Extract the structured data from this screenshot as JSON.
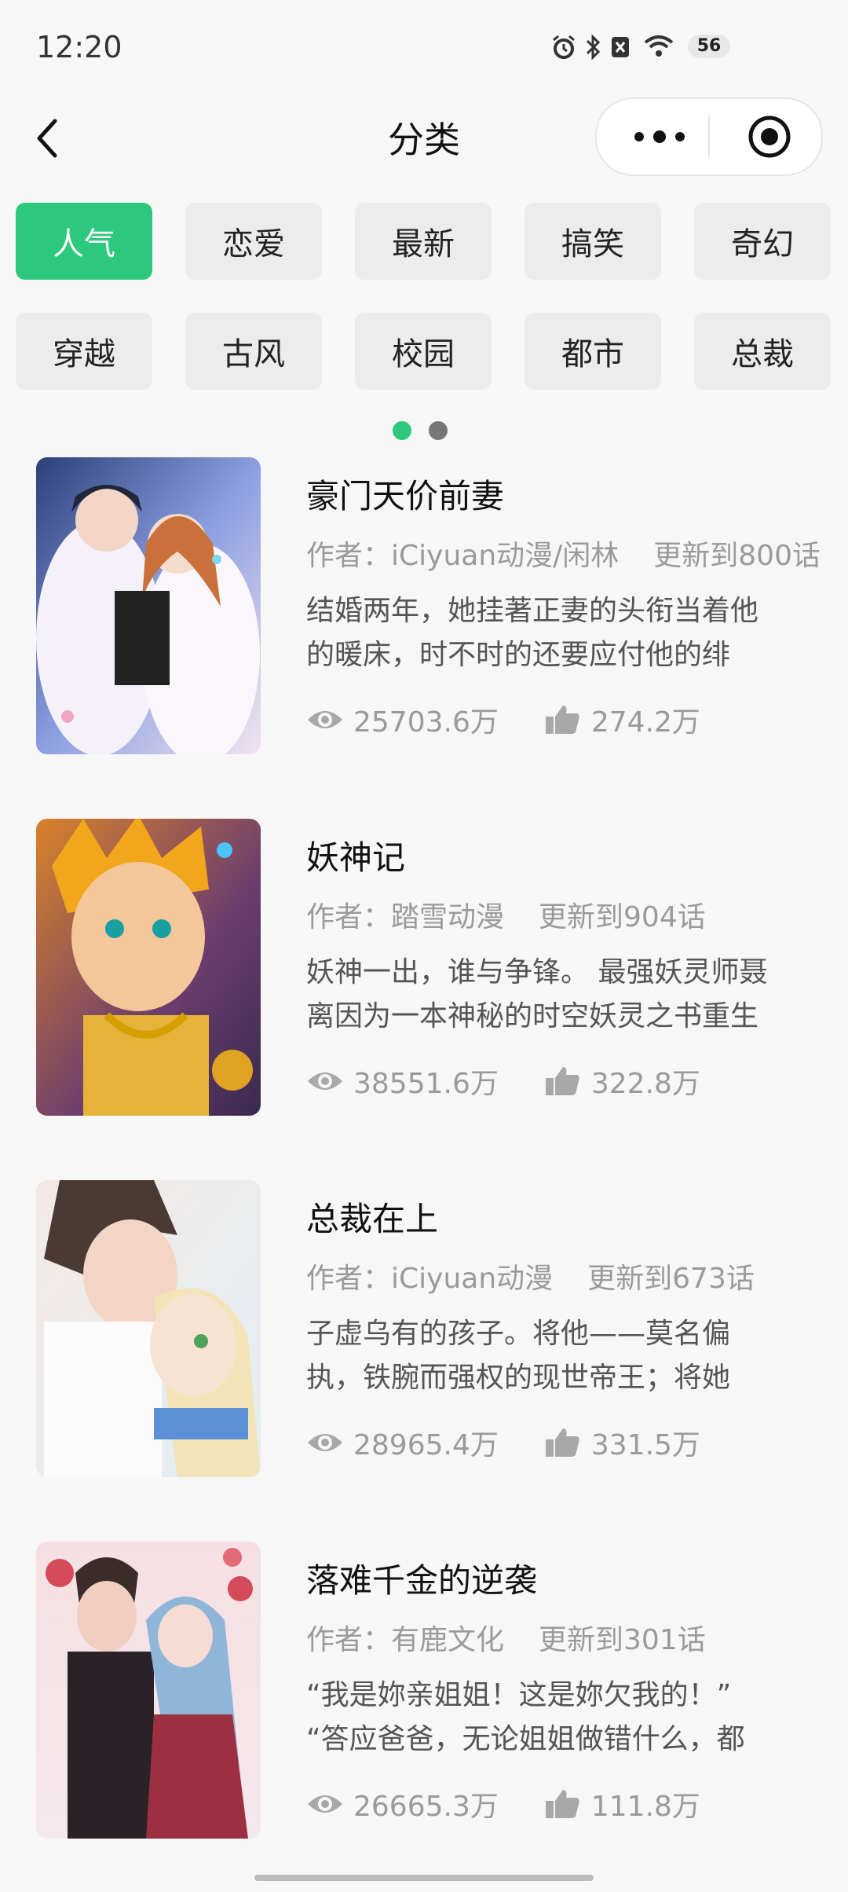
{
  "status_bar": {
    "time": "12:20",
    "battery": "56"
  },
  "header": {
    "title": "分类"
  },
  "categories": [
    {
      "label": "人气",
      "active": true
    },
    {
      "label": "恋爱",
      "active": false
    },
    {
      "label": "最新",
      "active": false
    },
    {
      "label": "搞笑",
      "active": false
    },
    {
      "label": "奇幻",
      "active": false
    },
    {
      "label": "穿越",
      "active": false
    },
    {
      "label": "古风",
      "active": false
    },
    {
      "label": "校园",
      "active": false
    },
    {
      "label": "都市",
      "active": false
    },
    {
      "label": "总裁",
      "active": false
    }
  ],
  "pager": {
    "pages": 2,
    "current": 1
  },
  "colors": {
    "accent": "#2cc97c"
  },
  "comics": [
    {
      "title": "豪门天价前妻",
      "author": "作者：iCiyuan动漫/闲林",
      "update": "更新到800话",
      "desc_line1": "结婚两年，她挂著正妻的头衔当着他",
      "desc_line2": "的暖床，时不时的还要应付他的绯",
      "views": "25703.6万",
      "likes": "274.2万"
    },
    {
      "title": "妖神记",
      "author": "作者：踏雪动漫",
      "update": "更新到904话",
      "desc_line1": "妖神一出，谁与争锋。 最强妖灵师聂",
      "desc_line2": "离因为一本神秘的时空妖灵之书重生",
      "views": "38551.6万",
      "likes": "322.8万"
    },
    {
      "title": "总裁在上",
      "author": "作者：iCiyuan动漫",
      "update": "更新到673话",
      "desc_line1": "子虚乌有的孩子。将他——莫名偏",
      "desc_line2": "执，铁腕而强权的现世帝王；将她",
      "views": "28965.4万",
      "likes": "331.5万"
    },
    {
      "title": "落难千金的逆袭",
      "author": "作者：有鹿文化",
      "update": "更新到301话",
      "desc_line1": "“我是妳亲姐姐！这是妳欠我的！”",
      "desc_line2": "“答应爸爸，无论姐姐做错什么，都",
      "views": "26665.3万",
      "likes": "111.8万"
    }
  ]
}
